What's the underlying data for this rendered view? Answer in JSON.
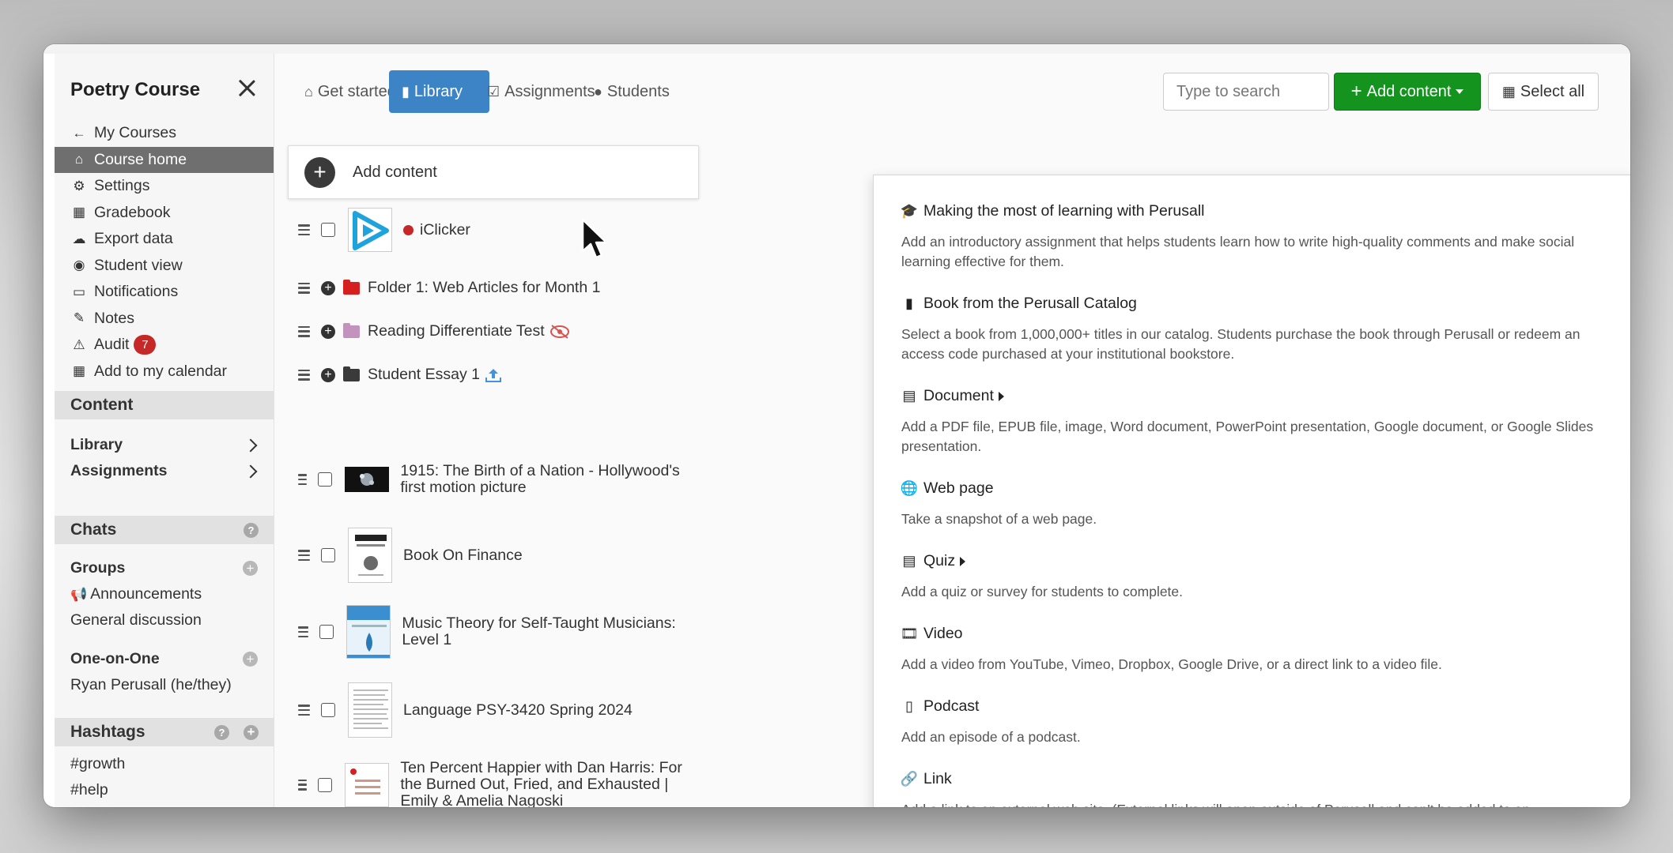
{
  "sidebar": {
    "course_title": "Poetry Course",
    "nav": [
      {
        "label": "My Courses",
        "icon": "arrow-left-icon",
        "glyph": "←"
      },
      {
        "label": "Course home",
        "icon": "home-icon",
        "glyph": "⌂",
        "active": true
      },
      {
        "label": "Settings",
        "icon": "gear-icon",
        "glyph": "⚙"
      },
      {
        "label": "Gradebook",
        "icon": "table-icon",
        "glyph": "▦"
      },
      {
        "label": "Export data",
        "icon": "cloud-download-icon",
        "glyph": "☁"
      },
      {
        "label": "Student view",
        "icon": "eye-icon",
        "glyph": "◉"
      },
      {
        "label": "Notifications",
        "icon": "inbox-icon",
        "glyph": "▭"
      },
      {
        "label": "Notes",
        "icon": "pencil-icon",
        "glyph": "✎"
      },
      {
        "label": "Audit",
        "icon": "warning-icon",
        "glyph": "⚠",
        "badge": "7"
      },
      {
        "label": "Add to my calendar",
        "icon": "calendar-icon",
        "glyph": "▦"
      }
    ],
    "content_header": "Content",
    "library_label": "Library",
    "assignments_label": "Assignments",
    "chats_header": "Chats",
    "groups_label": "Groups",
    "announcements_label": "Announcements",
    "general_discussion_label": "General discussion",
    "one_on_one_label": "One-on-One",
    "ryan_label": "Ryan Perusall (he/they)",
    "hashtags_header": "Hashtags",
    "hashtags": [
      "#growth",
      "#help"
    ]
  },
  "tabs": [
    {
      "label": "Get started",
      "icon": "home-icon",
      "glyph": "⌂"
    },
    {
      "label": "Library",
      "icon": "book-icon",
      "glyph": "▮",
      "active": true
    },
    {
      "label": "Assignments",
      "icon": "calendar-check-icon",
      "glyph": "☑"
    },
    {
      "label": "Students",
      "icon": "user-icon",
      "glyph": "●"
    }
  ],
  "toolbar": {
    "search_placeholder": "Type to search",
    "add_content_label": "Add content",
    "select_all_label": "Select all"
  },
  "library": {
    "add_content_label": "Add content",
    "items": [
      {
        "title": "iClicker"
      },
      {
        "title": "Folder 1: Web Articles for Month 1"
      },
      {
        "title": "Reading Differentiate Test"
      },
      {
        "title": "Student Essay 1"
      },
      {
        "title": "1915: The Birth of a Nation - Hollywood's first motion picture"
      },
      {
        "title": "Book On Finance"
      },
      {
        "title": "Music Theory for Self-Taught Musicians: Level 1"
      },
      {
        "title": "Language PSY-3420 Spring 2024"
      },
      {
        "title": "Ten Percent Happier with Dan Harris: For the Burned Out, Fried, and Exhausted | Emily & Amelia Nagoski"
      }
    ]
  },
  "dropdown": {
    "options": [
      {
        "title": "Making the most of learning with Perusall",
        "icon": "graduation-cap-icon",
        "glyph": "🎓",
        "desc": "Add an introductory assignment that helps students learn how to write high-quality comments and make social learning effective for them."
      },
      {
        "title": "Book from the Perusall Catalog",
        "icon": "book-icon",
        "glyph": "▮",
        "desc": "Select a book from 1,000,000+ titles in our catalog. Students purchase the book through Perusall or redeem an access code purchased at your institutional bookstore."
      },
      {
        "title": "Document",
        "icon": "file-icon",
        "glyph": "▤",
        "submenu": true,
        "desc": "Add a PDF file, EPUB file, image, Word document, PowerPoint presentation, Google document, or Google Slides presentation."
      },
      {
        "title": "Web page",
        "icon": "globe-icon",
        "glyph": "🌐",
        "desc": "Take a snapshot of a web page."
      },
      {
        "title": "Quiz",
        "icon": "file-icon",
        "glyph": "▤",
        "submenu": true,
        "desc": "Add a quiz or survey for students to complete."
      },
      {
        "title": "Video",
        "icon": "film-icon",
        "glyph": "🎞",
        "desc": "Add a video from YouTube, Vimeo, Dropbox, Google Drive, or a direct link to a video file."
      },
      {
        "title": "Podcast",
        "icon": "audio-file-icon",
        "glyph": "▯",
        "desc": "Add an episode of a podcast."
      },
      {
        "title": "Link",
        "icon": "link-icon",
        "glyph": "🔗",
        "desc": "Add a link to an external web site. (External links will open outside of Perusall and can't be added to an assignment.)"
      }
    ]
  },
  "colors": {
    "primary_blue": "#3d84c6",
    "success_green": "#14931f",
    "badge_red": "#c62828",
    "active_nav": "#6f6f6f"
  }
}
